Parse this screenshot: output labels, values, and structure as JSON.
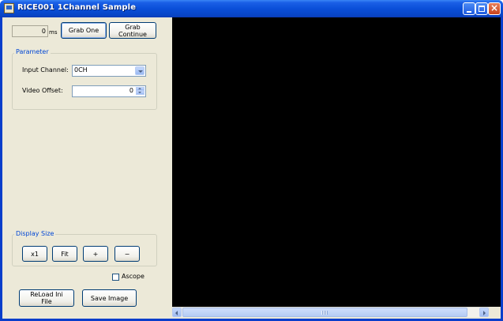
{
  "window": {
    "title": "RICE001 1Channel Sample",
    "controls": [
      "minimize-icon",
      "maximize-icon",
      "close-icon"
    ]
  },
  "toolbar": {
    "time_value": "0",
    "time_unit": "ms",
    "grab_one_label": "Grab One",
    "grab_continue_label": "Grab Continue"
  },
  "parameter": {
    "group_title": "Parameter",
    "input_channel_label": "Input Channel:",
    "input_channel_value": "0CH",
    "video_offset_label": "Video Offset:",
    "video_offset_value": "0"
  },
  "display_size": {
    "group_title": "Display Size",
    "x1_label": "x1",
    "fit_label": "Fit",
    "zoom_in_label": "+",
    "zoom_out_label": "−"
  },
  "ascope": {
    "label": "Ascope",
    "checked": false
  },
  "bottom": {
    "reload_label": "ReLoad Ini File",
    "save_label": "Save Image"
  },
  "colors": {
    "title_bar": "#0a4fd8",
    "window_background": "#ece9d8",
    "image_background": "#000000",
    "group_title": "#0046d5"
  }
}
